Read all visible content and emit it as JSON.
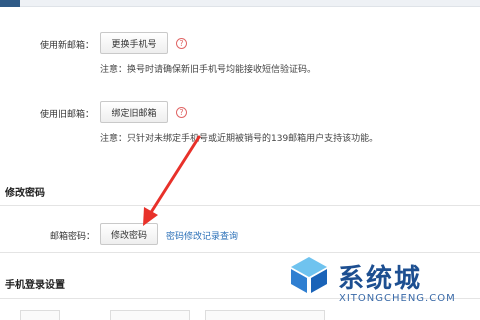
{
  "rows": {
    "new_email": {
      "label": "使用新邮箱：",
      "button": "更换手机号",
      "help": "?",
      "note": "注意：换号时请确保新旧手机号均能接收短信验证码。"
    },
    "old_email": {
      "label": "使用旧邮箱：",
      "button": "绑定旧邮箱",
      "help": "?",
      "note": "注意：只针对未绑定手机号或近期被销号的139邮箱用户支持该功能。"
    },
    "password": {
      "label": "邮箱密码：",
      "button": "修改密码",
      "link": "密码修改记录查询"
    }
  },
  "sections": {
    "change_password": "修改密码",
    "phone_login": "手机登录设置"
  },
  "watermark": {
    "title": "系统城",
    "subtitle": "XITONGCHENG.COM"
  },
  "colors": {
    "arrow": "#e8312a",
    "link": "#2a6fb7",
    "help": "#e06666",
    "watermark": "#1d4f91"
  }
}
